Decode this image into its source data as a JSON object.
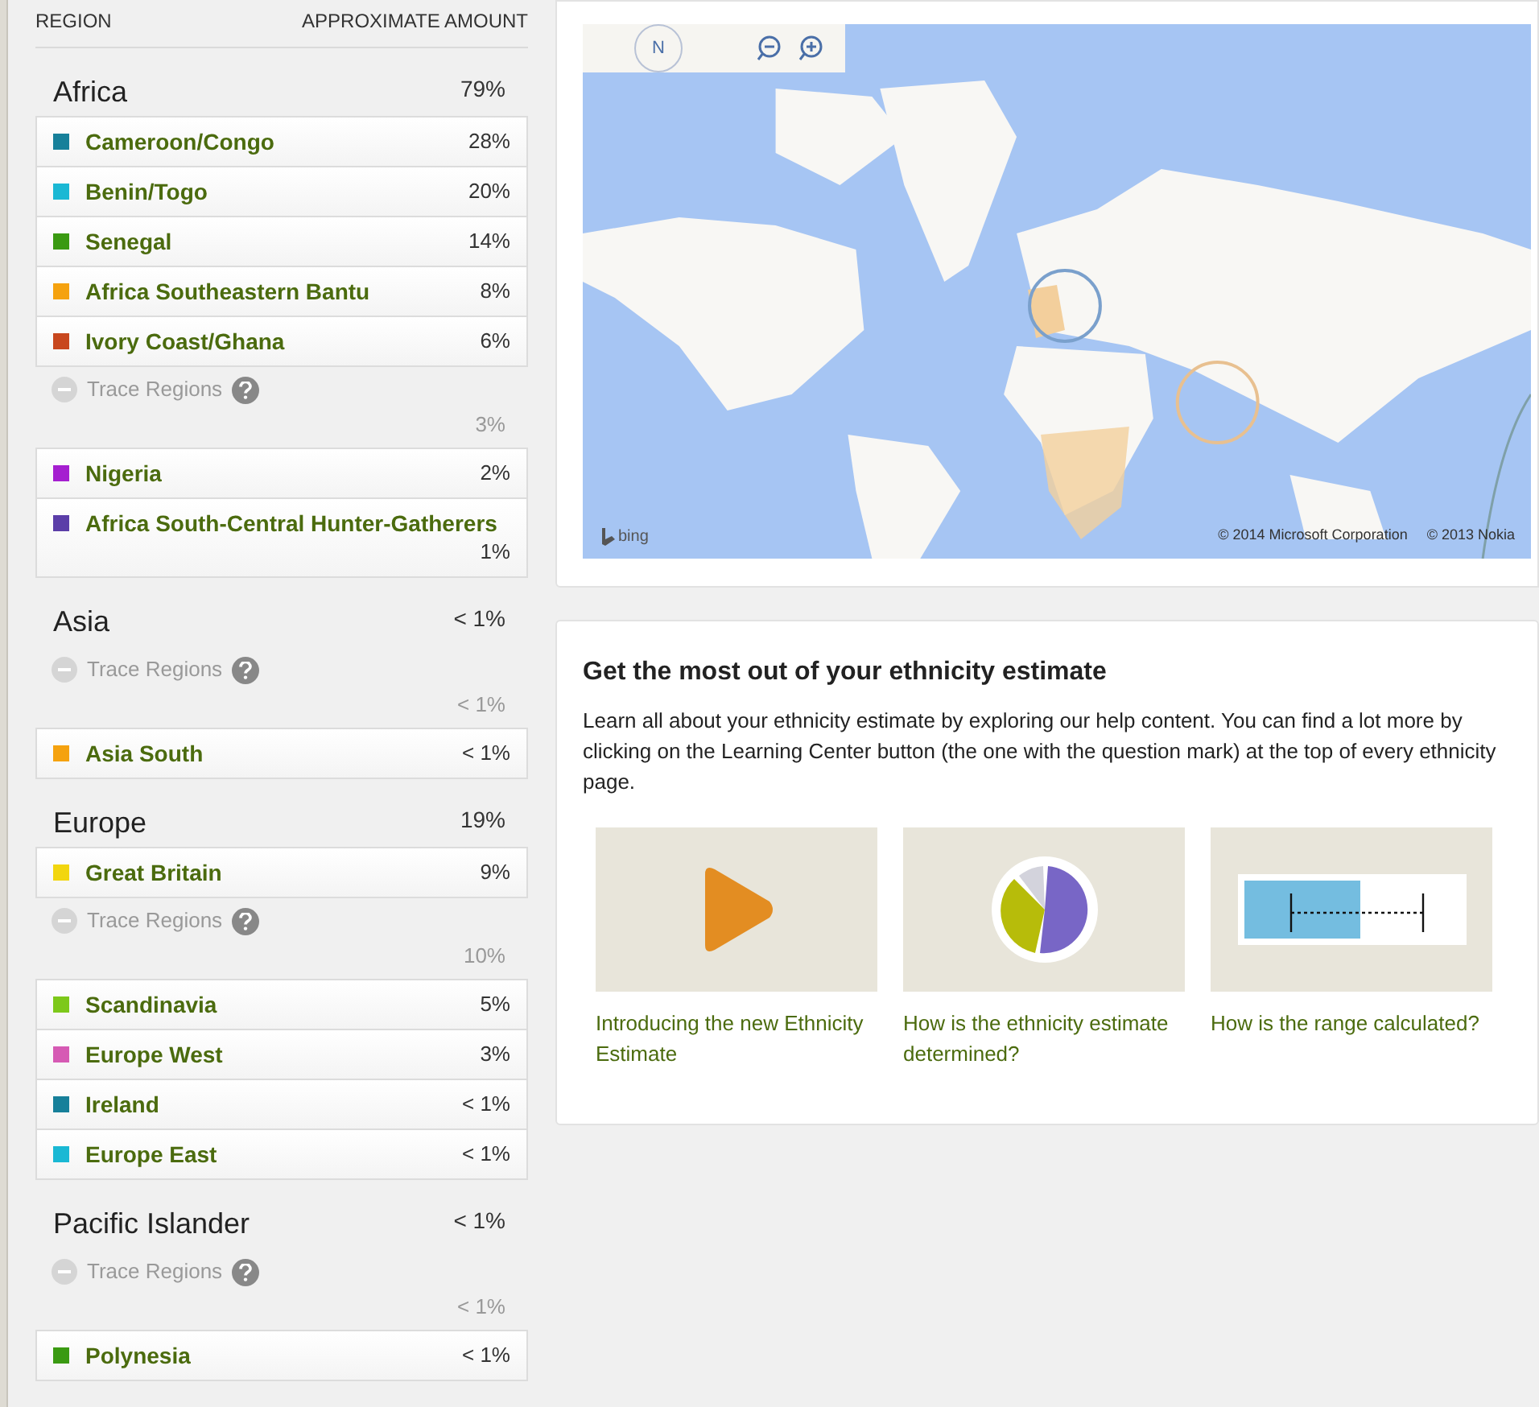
{
  "table": {
    "columns": [
      "REGION",
      "APPROXIMATE AMOUNT"
    ],
    "groups": [
      {
        "name": "Africa",
        "amount": "79%",
        "regions": [
          {
            "name": "Cameroon/Congo",
            "amount": "28%",
            "color": "#17809a"
          },
          {
            "name": "Benin/Togo",
            "amount": "20%",
            "color": "#1ab8d4"
          },
          {
            "name": "Senegal",
            "amount": "14%",
            "color": "#3a9a12"
          },
          {
            "name": "Africa Southeastern Bantu",
            "amount": "8%",
            "color": "#f5a20f"
          },
          {
            "name": "Ivory Coast/Ghana",
            "amount": "6%",
            "color": "#c8471e"
          }
        ],
        "trace": {
          "label": "Trace Regions",
          "expanded": true,
          "amount": "3%",
          "regions": [
            {
              "name": "Nigeria",
              "amount": "2%",
              "color": "#a51fd0"
            },
            {
              "name": "Africa South-Central Hunter-Gatherers",
              "amount": "1%",
              "color": "#5b3ea8"
            }
          ]
        }
      },
      {
        "name": "Asia",
        "amount": "< 1%",
        "trace": {
          "label": "Trace Regions",
          "expanded": true,
          "amount": "< 1%",
          "regions": [
            {
              "name": "Asia South",
              "amount": "< 1%",
              "color": "#f5a20f"
            }
          ]
        }
      },
      {
        "name": "Europe",
        "amount": "19%",
        "regions": [
          {
            "name": "Great Britain",
            "amount": "9%",
            "color": "#f2d60f"
          }
        ],
        "trace": {
          "label": "Trace Regions",
          "expanded": true,
          "amount": "10%",
          "regions": [
            {
              "name": "Scandinavia",
              "amount": "5%",
              "color": "#7dc81a"
            },
            {
              "name": "Europe West",
              "amount": "3%",
              "color": "#d65ab4"
            },
            {
              "name": "Ireland",
              "amount": "< 1%",
              "color": "#17809a"
            },
            {
              "name": "Europe East",
              "amount": "< 1%",
              "color": "#1ab8d4"
            }
          ]
        }
      },
      {
        "name": "Pacific Islander",
        "amount": "< 1%",
        "trace": {
          "label": "Trace Regions",
          "expanded": true,
          "amount": "< 1%",
          "regions": [
            {
              "name": "Polynesia",
              "amount": "< 1%",
              "color": "#3a9a12"
            }
          ]
        }
      }
    ]
  },
  "map": {
    "kind": "picture",
    "compass_label": "N",
    "logo_text": "bing",
    "copyright": [
      "© 2014 Microsoft Corporation",
      "© 2013 Nokia"
    ]
  },
  "help": {
    "title": "Get the most out of your ethnicity estimate",
    "text": "Learn all about your ethnicity estimate by exploring our help content. You can find a lot more by clicking on the Learning Center button (the one with the question mark) at the top of every ethnicity page.",
    "videos": [
      {
        "kind": "play",
        "caption": "Introducing the new Ethnicity Estimate"
      },
      {
        "kind": "pie",
        "caption": "How is the ethnicity estimate determined?"
      },
      {
        "kind": "range",
        "caption": "How is the range calculated?"
      }
    ]
  }
}
